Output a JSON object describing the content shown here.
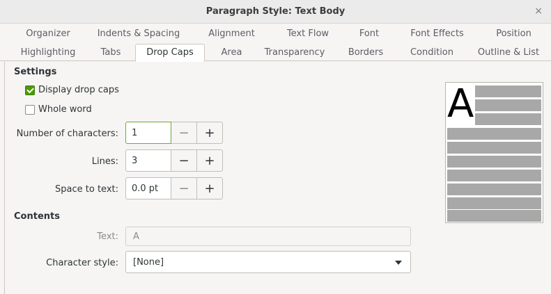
{
  "window": {
    "title": "Paragraph Style: Text Body",
    "close_glyph": "×"
  },
  "tabs_row1": [
    "Organizer",
    "Indents & Spacing",
    "Alignment",
    "Text Flow",
    "Font",
    "Font Effects",
    "Position"
  ],
  "tabs_row2": [
    "Highlighting",
    "Tabs",
    "Drop Caps",
    "Area",
    "Transparency",
    "Borders",
    "Condition",
    "Outline & List"
  ],
  "active_tab": "Drop Caps",
  "settings": {
    "title": "Settings",
    "display_drop_caps": {
      "label": "Display drop caps",
      "checked": true
    },
    "whole_word": {
      "label": "Whole word",
      "checked": false
    },
    "num_chars": {
      "label": "Number of characters:",
      "value": "1"
    },
    "lines": {
      "label": "Lines:",
      "value": "3"
    },
    "space": {
      "label": "Space to text:",
      "value": "0.0 pt"
    },
    "minus": "−",
    "plus": "+"
  },
  "contents": {
    "title": "Contents",
    "text_label": "Text:",
    "text_value": "A",
    "char_style_label": "Character style:",
    "char_style_value": "[None]"
  },
  "preview": {
    "drop_letter": "A"
  },
  "colors": {
    "accent": "#4e9a06",
    "preview_bar": "#a8a8a8"
  }
}
